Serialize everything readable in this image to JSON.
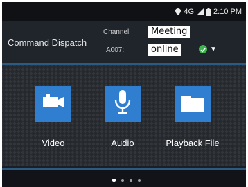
{
  "status_bar": {
    "network": "4G",
    "time": "2:10 PM",
    "icons": [
      "location-icon",
      "signal-icon",
      "battery-icon"
    ]
  },
  "header": {
    "title": "Command Dispatch",
    "channel_label": "Channel",
    "channel_value": "Meeting",
    "device_label": "A007:",
    "status_value": "online",
    "status_color": "#3fb34f"
  },
  "tiles": [
    {
      "label": "Video",
      "icon": "video-camera-icon"
    },
    {
      "label": "Audio",
      "icon": "microphone-icon"
    },
    {
      "label": "Playback File",
      "icon": "folder-icon"
    }
  ],
  "pagination": {
    "pages": 4,
    "current": 1
  },
  "colors": {
    "accent": "#2f7ed0",
    "bar_line": "#2b5a82"
  }
}
